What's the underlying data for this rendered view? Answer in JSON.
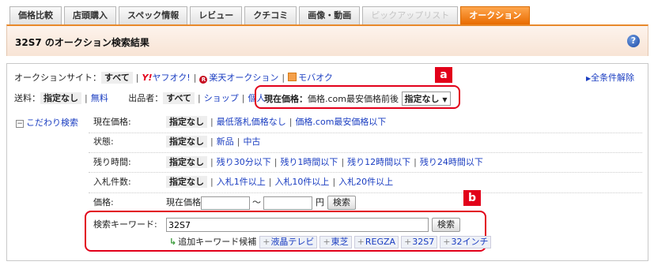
{
  "tabs": [
    {
      "label": "価格比較"
    },
    {
      "label": "店頭購入"
    },
    {
      "label": "スペック情報"
    },
    {
      "label": "レビュー"
    },
    {
      "label": "クチコミ"
    },
    {
      "label": "画像・動画"
    },
    {
      "label": "ピックアップリスト"
    },
    {
      "label": "オークション"
    }
  ],
  "title": "32S7 のオークション検索結果",
  "help_icon": "?",
  "sites": {
    "label": "オークションサイト：",
    "all": "すべて",
    "yahoo": "ヤフオク!",
    "rakuten": "楽天オークション",
    "mobaoku": "モバオク"
  },
  "reset_all": "全条件解除",
  "shipping": {
    "label": "送料：",
    "selected": "指定なし",
    "free": "無料"
  },
  "seller": {
    "label": "出品者：",
    "selected": "すべて",
    "shop": "ショップ",
    "individual": "個人"
  },
  "current_price_filter": {
    "label": "現在価格：",
    "desc": "価格.com最安価格前後",
    "select": "指定なし"
  },
  "markers": {
    "a": "a",
    "b": "b"
  },
  "kodawari": "こだわり検索",
  "filters": {
    "price": {
      "label": "現在価格:",
      "selected": "指定なし",
      "opt1": "最低落札価格なし",
      "opt2": "価格.com最安価格以下"
    },
    "state": {
      "label": "状態:",
      "selected": "指定なし",
      "opt1": "新品",
      "opt2": "中古"
    },
    "remaining": {
      "label": "残り時間:",
      "selected": "指定なし",
      "opt1": "残り30分以下",
      "opt2": "残り1時間以下",
      "opt3": "残り12時間以下",
      "opt4": "残り24時間以下"
    },
    "bids": {
      "label": "入札件数:",
      "selected": "指定なし",
      "opt1": "入札1件以上",
      "opt2": "入札10件以上",
      "opt3": "入札20件以上"
    },
    "pricerange": {
      "label": "価格:",
      "current": "現在価格",
      "tilde": "〜",
      "yen": "円",
      "search": "検索"
    }
  },
  "keyword": {
    "label": "検索キーワード:",
    "value": "32S7",
    "search": "検索",
    "suggest_label": "追加キーワード候補",
    "suggestions": [
      "液晶テレビ",
      "東芝",
      "REGZA",
      "32S7",
      "32インチ"
    ]
  }
}
